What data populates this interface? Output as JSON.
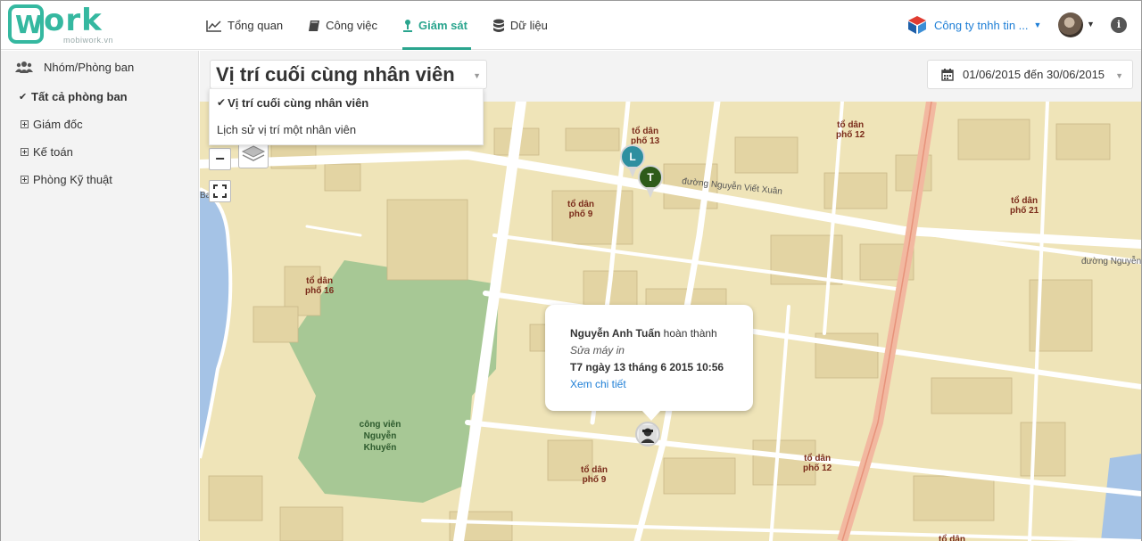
{
  "brand": {
    "logo_main": "W",
    "logo_rest": "ork",
    "logo_sub": "mobiwork.vn"
  },
  "nav": [
    {
      "label": "Tổng quan",
      "icon": "line-chart-icon",
      "active": false
    },
    {
      "label": "Công việc",
      "icon": "book-icon",
      "active": false
    },
    {
      "label": "Giám sát",
      "icon": "location-pin-icon",
      "active": true
    },
    {
      "label": "Dữ liệu",
      "icon": "database-icon",
      "active": false
    }
  ],
  "header": {
    "company": "Công ty tnhh tin ...",
    "accent_color": "#2aa58e",
    "link_color": "#1f7fd6",
    "info_label": "i"
  },
  "sidebar": {
    "title": "Nhóm/Phòng ban",
    "items": [
      {
        "label": "Tất cả phòng ban",
        "selected": true
      },
      {
        "label": "Giám đốc",
        "selected": false
      },
      {
        "label": "Kế toán",
        "selected": false
      },
      {
        "label": "Phòng Kỹ thuật",
        "selected": false
      }
    ]
  },
  "view": {
    "selected": "Vị trí cuối cùng nhân viên",
    "options": [
      {
        "label": "Vị trí cuối cùng nhân viên",
        "checked": true
      },
      {
        "label": "Lịch sử vị trí một nhân viên",
        "checked": false
      }
    ]
  },
  "date_range": "01/06/2015 đến 30/06/2015",
  "map": {
    "zoom_out_label": "−",
    "labels": {
      "street_1": "đường Nguyễn Viết Xuân",
      "street_2": "đường Nguyễn",
      "park": [
        "công viên",
        "Nguyễn",
        "Khuyến"
      ],
      "to_dan": "tổ dân",
      "pho_13": "phố 13",
      "pho_12": "phố 12",
      "pho_21": "phố 21",
      "pho_9": "phố 9",
      "pho_16": "phố 16",
      "edge_label": "Ba Đình"
    },
    "markers": [
      {
        "letter": "L",
        "color": "#2e8fa0"
      },
      {
        "letter": "T",
        "color": "#2e5b1a"
      }
    ],
    "popup": {
      "name": "Nguyễn Anh Tuấn",
      "status": "hoàn thành",
      "task": "Sửa máy in",
      "datetime": "T7 ngày 13 tháng 6 2015 10:56",
      "link": "Xem chi tiết"
    }
  }
}
